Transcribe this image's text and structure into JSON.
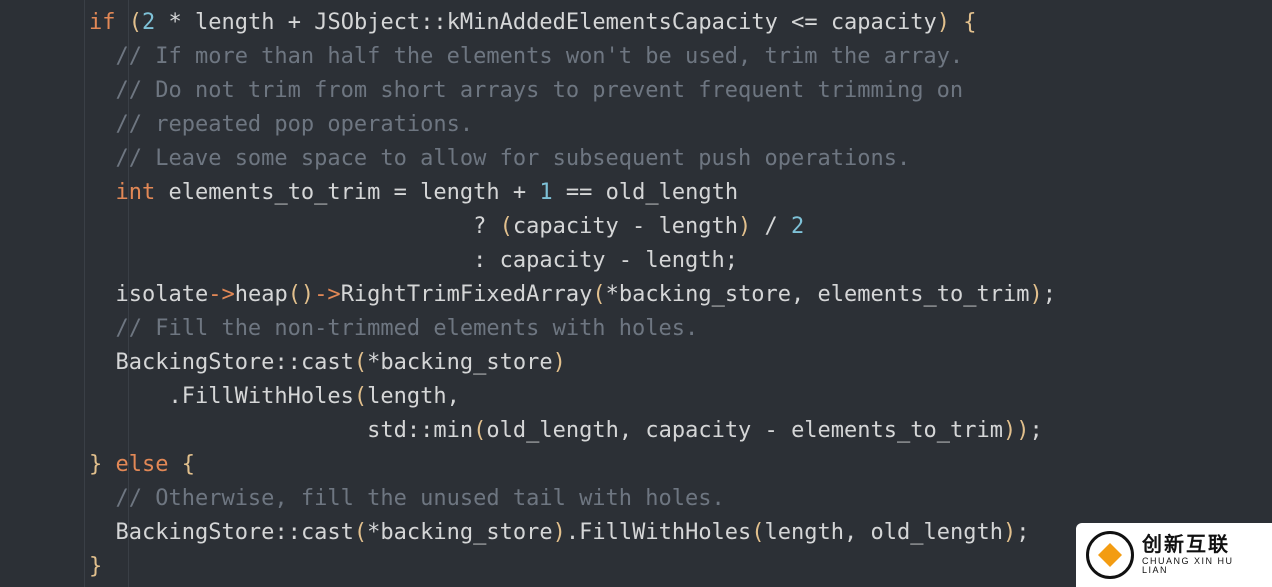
{
  "code": {
    "lines": [
      {
        "indent": "    ",
        "tokens": [
          {
            "c": "keyword",
            "t": "if"
          },
          {
            "c": "op",
            "t": " "
          },
          {
            "c": "paren",
            "t": "("
          },
          {
            "c": "num",
            "t": "2"
          },
          {
            "c": "op",
            "t": " * "
          },
          {
            "c": "ident",
            "t": "length"
          },
          {
            "c": "op",
            "t": " + "
          },
          {
            "c": "scope",
            "t": "JSObject"
          },
          {
            "c": "op",
            "t": "::"
          },
          {
            "c": "member",
            "t": "kMinAddedElementsCapacity"
          },
          {
            "c": "op",
            "t": " <= "
          },
          {
            "c": "ident",
            "t": "capacity"
          },
          {
            "c": "paren",
            "t": ")"
          },
          {
            "c": "op",
            "t": " "
          },
          {
            "c": "paren",
            "t": "{"
          }
        ]
      },
      {
        "indent": "      ",
        "tokens": [
          {
            "c": "comment",
            "t": "// If more than half the elements won't be used, trim the array."
          }
        ]
      },
      {
        "indent": "      ",
        "tokens": [
          {
            "c": "comment",
            "t": "// Do not trim from short arrays to prevent frequent trimming on"
          }
        ]
      },
      {
        "indent": "      ",
        "tokens": [
          {
            "c": "comment",
            "t": "// repeated pop operations."
          }
        ]
      },
      {
        "indent": "      ",
        "tokens": [
          {
            "c": "comment",
            "t": "// Leave some space to allow for subsequent push operations."
          }
        ]
      },
      {
        "indent": "      ",
        "tokens": [
          {
            "c": "type",
            "t": "int"
          },
          {
            "c": "op",
            "t": " "
          },
          {
            "c": "ident",
            "t": "elements_to_trim"
          },
          {
            "c": "op",
            "t": " = "
          },
          {
            "c": "ident",
            "t": "length"
          },
          {
            "c": "op",
            "t": " + "
          },
          {
            "c": "num",
            "t": "1"
          },
          {
            "c": "op",
            "t": " == "
          },
          {
            "c": "ident",
            "t": "old_length"
          }
        ]
      },
      {
        "indent": "                                 ",
        "tokens": [
          {
            "c": "op",
            "t": "? "
          },
          {
            "c": "paren",
            "t": "("
          },
          {
            "c": "ident",
            "t": "capacity"
          },
          {
            "c": "op",
            "t": " - "
          },
          {
            "c": "ident",
            "t": "length"
          },
          {
            "c": "paren",
            "t": ")"
          },
          {
            "c": "op",
            "t": " / "
          },
          {
            "c": "num",
            "t": "2"
          }
        ]
      },
      {
        "indent": "                                 ",
        "tokens": [
          {
            "c": "op",
            "t": ": "
          },
          {
            "c": "ident",
            "t": "capacity"
          },
          {
            "c": "op",
            "t": " - "
          },
          {
            "c": "ident",
            "t": "length"
          },
          {
            "c": "op",
            "t": ";"
          }
        ]
      },
      {
        "indent": "      ",
        "tokens": [
          {
            "c": "ident",
            "t": "isolate"
          },
          {
            "c": "arrow",
            "t": "->"
          },
          {
            "c": "member",
            "t": "heap"
          },
          {
            "c": "paren",
            "t": "()"
          },
          {
            "c": "arrow",
            "t": "->"
          },
          {
            "c": "member",
            "t": "RightTrimFixedArray"
          },
          {
            "c": "paren",
            "t": "("
          },
          {
            "c": "op",
            "t": "*"
          },
          {
            "c": "ident",
            "t": "backing_store"
          },
          {
            "c": "op",
            "t": ", "
          },
          {
            "c": "ident",
            "t": "elements_to_trim"
          },
          {
            "c": "paren",
            "t": ")"
          },
          {
            "c": "op",
            "t": ";"
          }
        ]
      },
      {
        "indent": "      ",
        "tokens": [
          {
            "c": "comment",
            "t": "// Fill the non-trimmed elements with holes."
          }
        ]
      },
      {
        "indent": "      ",
        "tokens": [
          {
            "c": "scope",
            "t": "BackingStore"
          },
          {
            "c": "op",
            "t": "::"
          },
          {
            "c": "member",
            "t": "cast"
          },
          {
            "c": "paren",
            "t": "("
          },
          {
            "c": "op",
            "t": "*"
          },
          {
            "c": "ident",
            "t": "backing_store"
          },
          {
            "c": "paren",
            "t": ")"
          }
        ]
      },
      {
        "indent": "          ",
        "tokens": [
          {
            "c": "op",
            "t": "."
          },
          {
            "c": "member",
            "t": "FillWithHoles"
          },
          {
            "c": "paren",
            "t": "("
          },
          {
            "c": "ident",
            "t": "length"
          },
          {
            "c": "op",
            "t": ","
          }
        ]
      },
      {
        "indent": "                         ",
        "tokens": [
          {
            "c": "scope",
            "t": "std"
          },
          {
            "c": "op",
            "t": "::"
          },
          {
            "c": "member",
            "t": "min"
          },
          {
            "c": "paren",
            "t": "("
          },
          {
            "c": "ident",
            "t": "old_length"
          },
          {
            "c": "op",
            "t": ", "
          },
          {
            "c": "ident",
            "t": "capacity"
          },
          {
            "c": "op",
            "t": " - "
          },
          {
            "c": "ident",
            "t": "elements_to_trim"
          },
          {
            "c": "paren",
            "t": "))"
          },
          {
            "c": "op",
            "t": ";"
          }
        ]
      },
      {
        "indent": "    ",
        "tokens": [
          {
            "c": "paren",
            "t": "}"
          },
          {
            "c": "op",
            "t": " "
          },
          {
            "c": "keyword",
            "t": "else"
          },
          {
            "c": "op",
            "t": " "
          },
          {
            "c": "paren",
            "t": "{"
          }
        ]
      },
      {
        "indent": "      ",
        "tokens": [
          {
            "c": "comment",
            "t": "// Otherwise, fill the unused tail with holes."
          }
        ]
      },
      {
        "indent": "      ",
        "tokens": [
          {
            "c": "scope",
            "t": "BackingStore"
          },
          {
            "c": "op",
            "t": "::"
          },
          {
            "c": "member",
            "t": "cast"
          },
          {
            "c": "paren",
            "t": "("
          },
          {
            "c": "op",
            "t": "*"
          },
          {
            "c": "ident",
            "t": "backing_store"
          },
          {
            "c": "paren",
            "t": ")"
          },
          {
            "c": "op",
            "t": "."
          },
          {
            "c": "member",
            "t": "FillWithHoles"
          },
          {
            "c": "paren",
            "t": "("
          },
          {
            "c": "ident",
            "t": "length"
          },
          {
            "c": "op",
            "t": ", "
          },
          {
            "c": "ident",
            "t": "old_length"
          },
          {
            "c": "paren",
            "t": ")"
          },
          {
            "c": "op",
            "t": ";"
          }
        ]
      },
      {
        "indent": "    ",
        "tokens": [
          {
            "c": "paren",
            "t": "}"
          }
        ]
      }
    ]
  },
  "watermark": {
    "cn": "创新互联",
    "en": "CHUANG XIN HU LIAN"
  }
}
